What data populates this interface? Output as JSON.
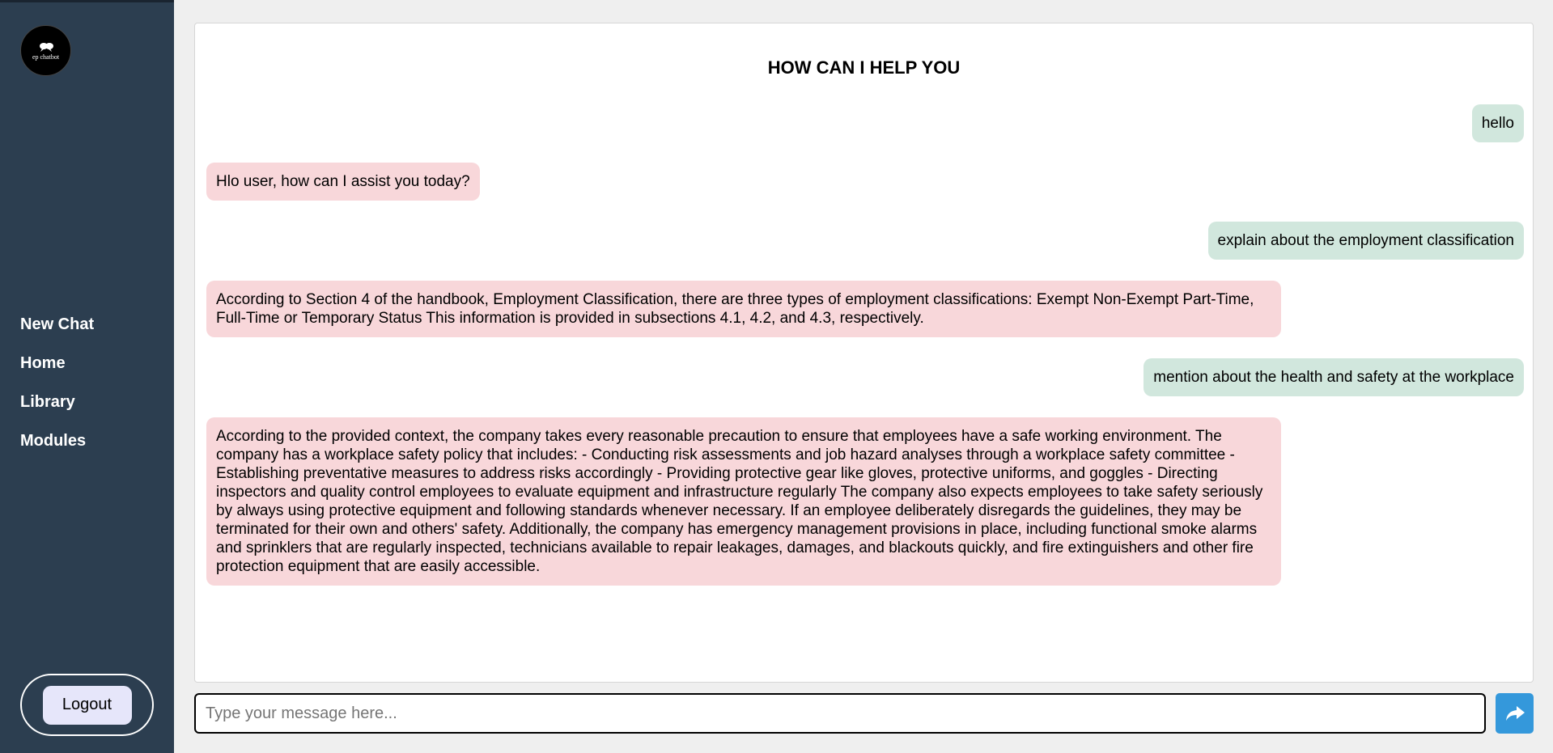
{
  "sidebar": {
    "logo_text": "ep chatbot",
    "nav": [
      "New Chat",
      "Home",
      "Library",
      "Modules"
    ],
    "logout_label": "Logout"
  },
  "chat": {
    "title": "HOW CAN I HELP YOU",
    "messages": [
      {
        "role": "user",
        "text": "hello"
      },
      {
        "role": "bot",
        "text": "Hlo user, how can I assist you today?"
      },
      {
        "role": "user",
        "text": "explain about the employment classification"
      },
      {
        "role": "bot",
        "text": "According to Section 4 of the handbook, Employment Classification, there are three types of employment classifications: Exempt Non-Exempt Part-Time, Full-Time or Temporary Status This information is provided in subsections 4.1, 4.2, and 4.3, respectively."
      },
      {
        "role": "user",
        "text": "mention about the health and safety at the workplace"
      },
      {
        "role": "bot",
        "text": "According to the provided context, the company takes every reasonable precaution to ensure that employees have a safe working environment. The company has a workplace safety policy that includes: - Conducting risk assessments and job hazard analyses through a workplace safety committee - Establishing preventative measures to address risks accordingly - Providing protective gear like gloves, protective uniforms, and goggles - Directing inspectors and quality control employees to evaluate equipment and infrastructure regularly The company also expects employees to take safety seriously by always using protective equipment and following standards whenever necessary. If an employee deliberately disregards the guidelines, they may be terminated for their own and others' safety. Additionally, the company has emergency management provisions in place, including functional smoke alarms and sprinklers that are regularly inspected, technicians available to repair leakages, damages, and blackouts quickly, and fire extinguishers and other fire protection equipment that are easily accessible."
      }
    ]
  },
  "composer": {
    "placeholder": "Type your message here...",
    "value": ""
  },
  "icons": {
    "logo": "chat-bubbles-icon",
    "send": "share-arrow-icon"
  },
  "colors": {
    "sidebar": "#2c3e50",
    "user_bubble": "#d1e7dd",
    "bot_bubble": "#f8d7da",
    "send_button": "#3498db"
  }
}
